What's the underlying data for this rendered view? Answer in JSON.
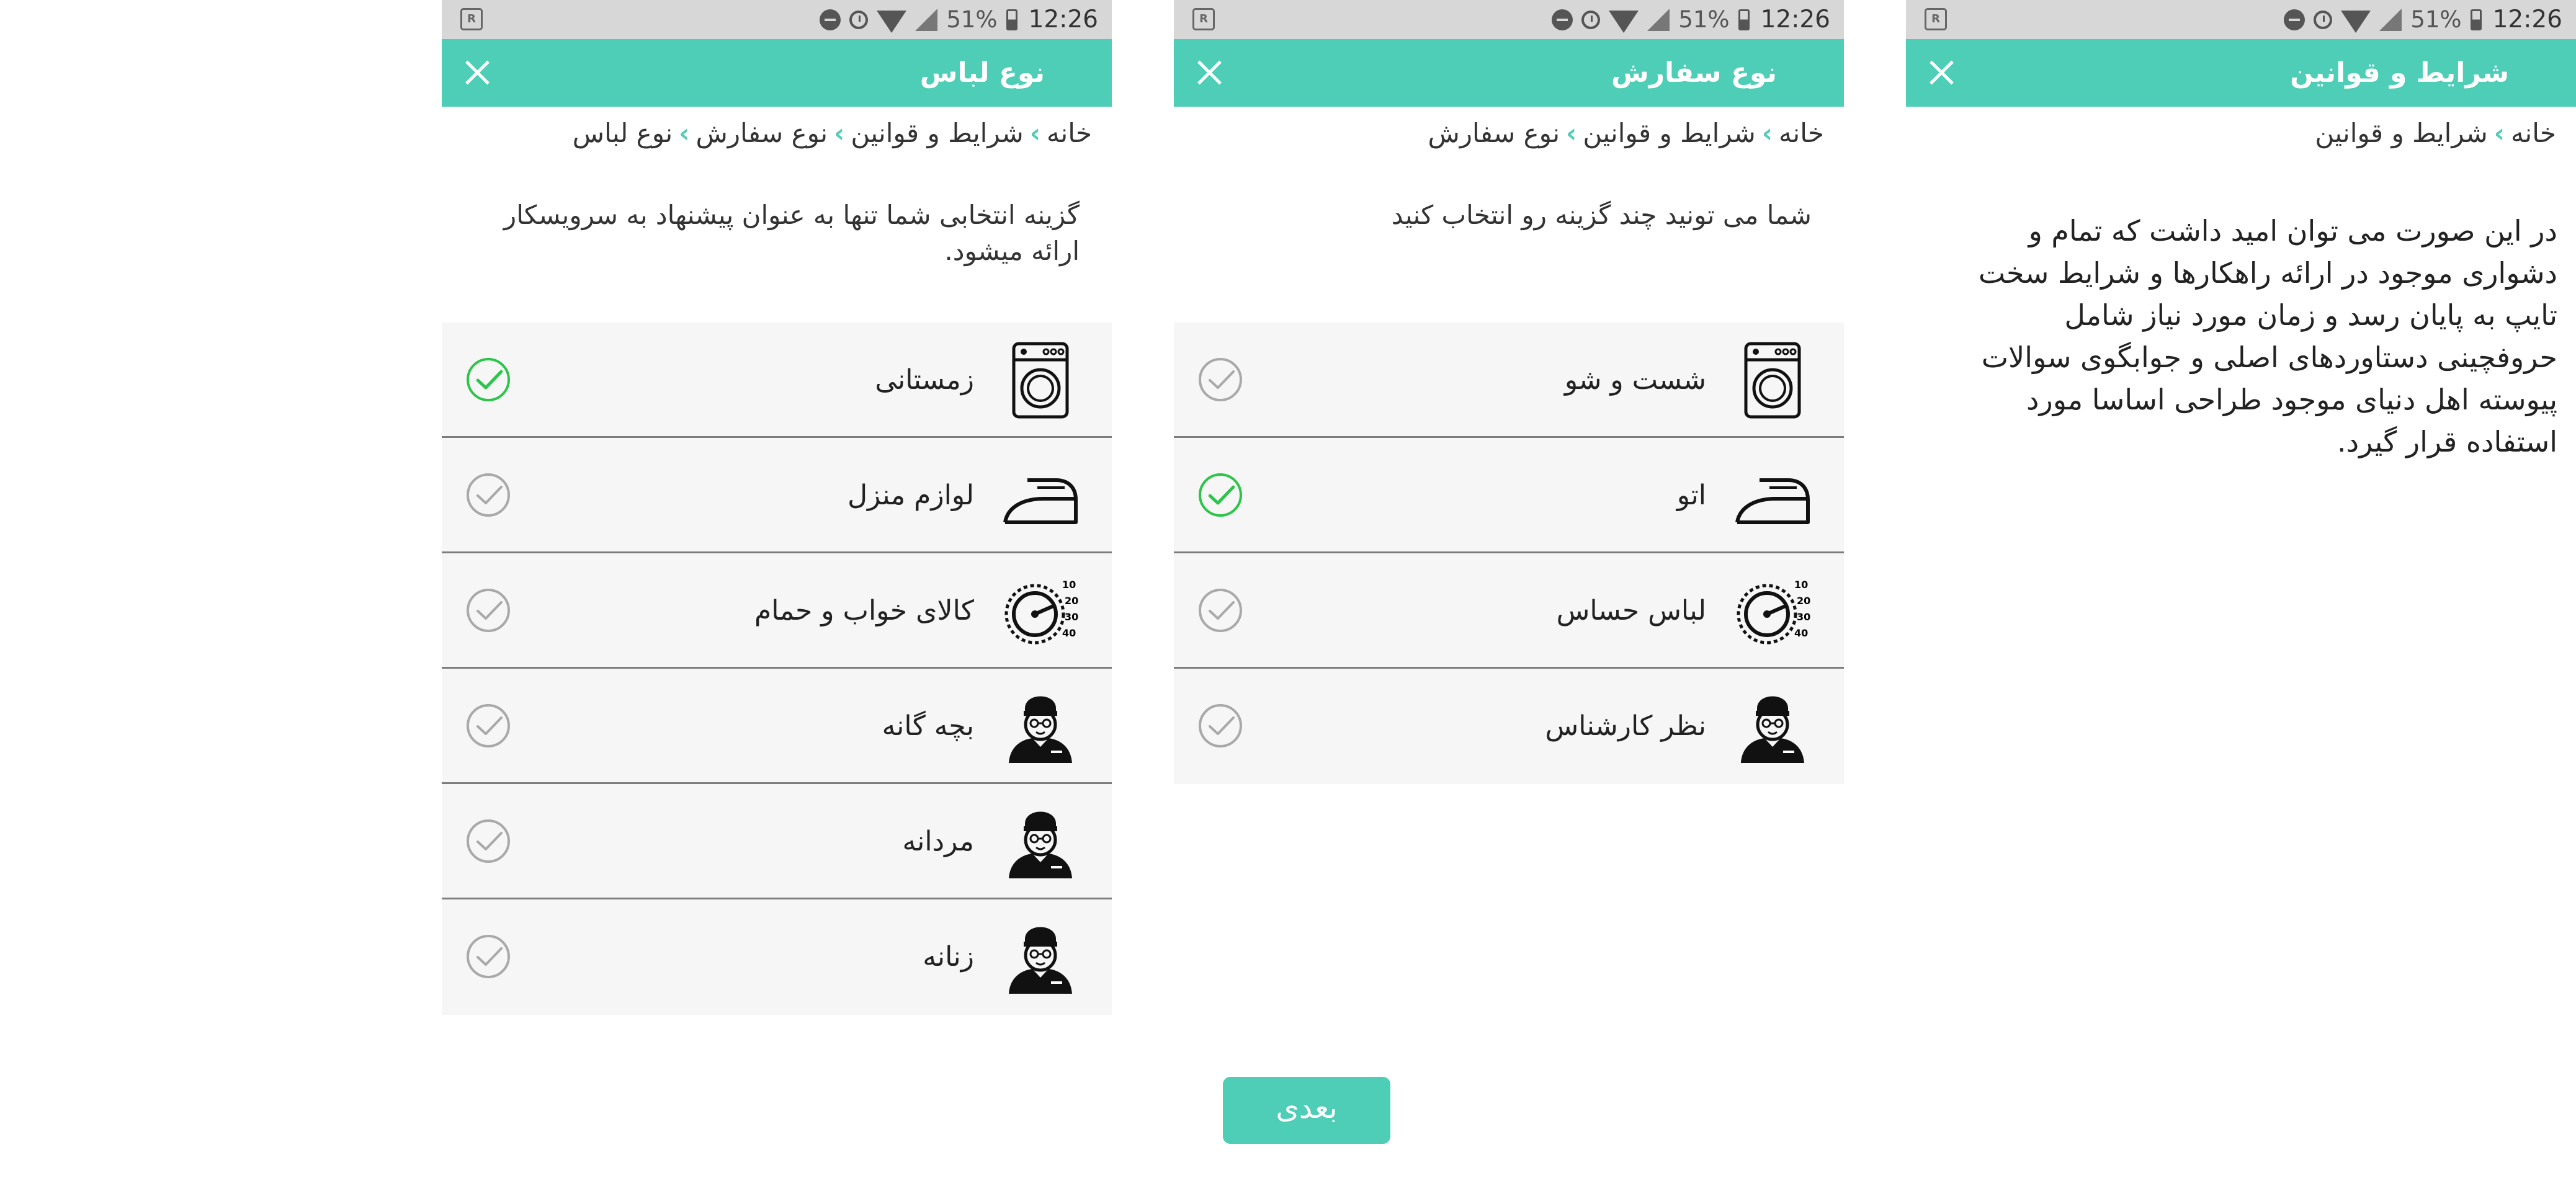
{
  "statusbar": {
    "battery_pct": "51%",
    "time": "12:26"
  },
  "screens": [
    {
      "title": "شرایط و قوانین",
      "breadcrumb": [
        "خانه",
        "شرایط و قوانین"
      ],
      "body": "در این صورت می توان امید داشت که تمام و دشواری موجود در ارائه راهکارها و شرایط سخت تایپ به پایان رسد و زمان مورد نیاز شامل حروفچینی دستاوردهای اصلی و جوابگوی سوالات پیوسته اهل دنیای موجود طراحی اساسا مورد استفاده قرار گیرد."
    },
    {
      "title": "نوع سفارش",
      "breadcrumb": [
        "خانه",
        "شرایط و قوانین",
        "نوع سفارش"
      ],
      "intro": "شما می تونید چند گزینه رو انتخاب کنید",
      "options": [
        {
          "label": "شست و شو",
          "icon": "washing-machine-icon",
          "selected": false
        },
        {
          "label": "اتو",
          "icon": "iron-icon",
          "selected": true
        },
        {
          "label": "لباس حساس",
          "icon": "temperature-dial-icon",
          "selected": false
        },
        {
          "label": "نظر کارشناس",
          "icon": "expert-person-icon",
          "selected": false
        }
      ]
    },
    {
      "title": "نوع لباس",
      "breadcrumb": [
        "خانه",
        "شرایط و قوانین",
        "نوع سفارش",
        "نوع لباس"
      ],
      "intro": "گزینه انتخابی شما تنها به عنوان پیشنهاد به سرویسکار ارائه میشود.",
      "options": [
        {
          "label": "زمستانی",
          "icon": "washing-machine-icon",
          "selected": true
        },
        {
          "label": "لوازم منزل",
          "icon": "iron-icon",
          "selected": false
        },
        {
          "label": "کالای خواب و حمام",
          "icon": "temperature-dial-icon",
          "selected": false
        },
        {
          "label": "بچه گانه",
          "icon": "person-icon",
          "selected": false
        },
        {
          "label": "مردانه",
          "icon": "person-icon",
          "selected": false
        },
        {
          "label": "زنانه",
          "icon": "person-icon",
          "selected": false
        }
      ]
    }
  ],
  "next_button": "بعدی",
  "colors": {
    "accent": "#4ecdb7",
    "check_on": "#2cc44a",
    "check_off": "#a9a9a9",
    "row_bg": "#f6f6f6"
  }
}
